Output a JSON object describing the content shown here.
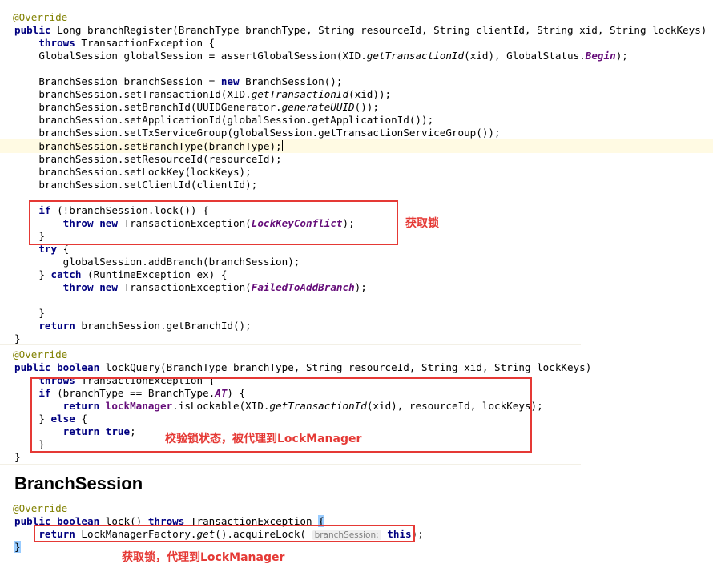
{
  "section1": {
    "annotation": "@Override",
    "sig_kw": "public",
    "sig_rest": " Long branchRegister(BranchType branchType, String resourceId, String clientId, String xid, String lockKeys)",
    "throws_kw": "throws",
    "throws_rest": " TransactionException {",
    "gs_pre": "GlobalSession globalSession = assertGlobalSession(XID.",
    "gs_method": "getTransactionId",
    "gs_mid": "(xid), GlobalStatus.",
    "gs_const": "Begin",
    "gs_end": ");",
    "bs_pre": "BranchSession branchSession = ",
    "bs_new": "new",
    "bs_end": " BranchSession();",
    "l1_pre": "branchSession.setTransactionId(XID.",
    "l1_method": "getTransactionId",
    "l1_end": "(xid));",
    "l2_pre": "branchSession.setBranchId(UUIDGenerator.",
    "l2_method": "generateUUID",
    "l2_end": "());",
    "l3": "branchSession.setApplicationId(globalSession.getApplicationId());",
    "l4": "branchSession.setTxServiceGroup(globalSession.getTransactionServiceGroup());",
    "l5": "branchSession.setBranchType(branchType);",
    "l6": "branchSession.setResourceId(resourceId);",
    "l7": "branchSession.setLockKey(lockKeys);",
    "l8": "branchSession.setClientId(clientId);",
    "if_kw": "if",
    "if_rest": " (!branchSession.lock()) {",
    "throw_kw": "throw",
    "new_kw": "new",
    "te_pre": " TransactionException(",
    "const_conflict": "LockKeyConflict",
    "te_end": ");",
    "close_brace": "}",
    "try_kw": "try",
    "try_rest": " {",
    "add_branch": "globalSession.addBranch(branchSession);",
    "catch_pre": "} ",
    "catch_kw": "catch",
    "catch_rest": " (RuntimeException ex) {",
    "const_failed": "FailedToAddBranch",
    "return_kw": "return",
    "return_rest": " branchSession.getBranchId();",
    "note": "获取锁"
  },
  "section2": {
    "annotation": "@Override",
    "public_kw": "public",
    "boolean_kw": "boolean",
    "sig_rest": " lockQuery(BranchType branchType, String resourceId, String xid, String lockKeys)",
    "throws_kw": "throws",
    "throws_rest": " TransactionException {",
    "if_kw": "if",
    "if_pre": " (branchType == BranchType.",
    "at_const": "AT",
    "if_end": ") {",
    "return_kw": "return",
    "lm_field": "lockManager",
    "lm_rest": ".isLockable(XID.",
    "lm_method": "getTransactionId",
    "lm_end": "(xid), resourceId, lockKeys);",
    "else_pre": "} ",
    "else_kw": "else",
    "else_rest": " {",
    "true_kw": "true",
    "semi": ";",
    "close_brace": "}",
    "note": "校验锁状态，被代理到LockManager"
  },
  "heading": "BranchSession",
  "section3": {
    "annotation": "@Override",
    "public_kw": "public",
    "boolean_kw": "boolean",
    "sig_mid": " lock() ",
    "throws_kw": "throws",
    "sig_end": " TransactionException ",
    "open_brace": "{",
    "return_kw": "return",
    "call_pre": " LockManagerFactory.",
    "get_method": "get",
    "call_mid": "().acquireLock( ",
    "hint": "branchSession:",
    "this_kw": "this",
    "call_end": ");",
    "close_brace": "}",
    "note": "获取锁，代理到LockManager"
  },
  "colors": {
    "keyword": "#000080",
    "annotation": "#808000",
    "constant": "#660e7a",
    "red_annotation": "#e53935",
    "caret_line_bg": "#fffae3"
  }
}
